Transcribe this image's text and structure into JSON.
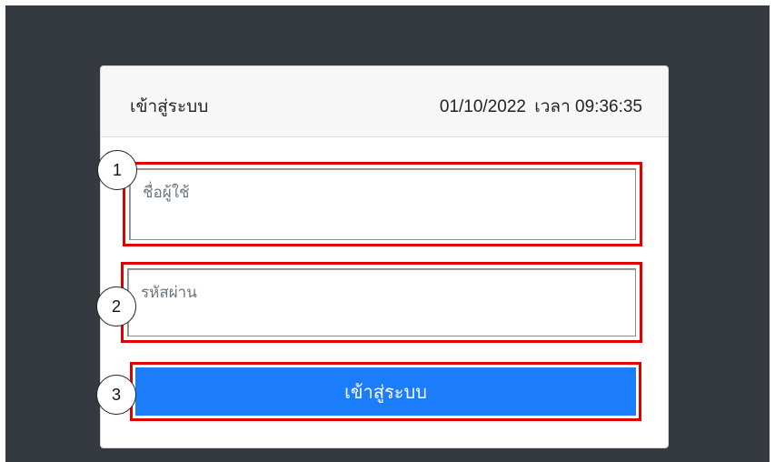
{
  "login": {
    "title": "เข้าสู่ระบบ",
    "date": "01/10/2022",
    "time_label": "เวลา",
    "time": "09:36:35",
    "username_placeholder": "ชื่อผู้ใช้",
    "password_placeholder": "รหัสผ่าน",
    "submit_label": "เข้าสู่ระบบ"
  },
  "annotations": {
    "marker_1": "1",
    "marker_2": "2",
    "marker_3": "3",
    "highlight_color": "#e00000"
  },
  "colors": {
    "background": "#343a40",
    "primary_button": "#1c7dfb"
  }
}
